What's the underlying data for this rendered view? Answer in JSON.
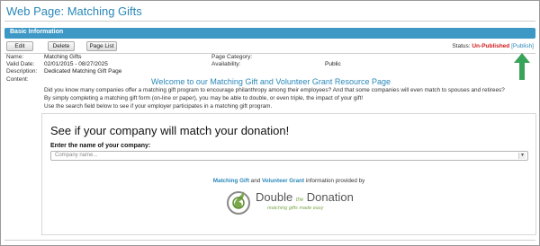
{
  "page_title": "Web Page: Matching Gifts",
  "section": {
    "title": "Basic Information"
  },
  "toolbar": {
    "edit_label": "Edit",
    "delete_label": "Delete",
    "page_list_label": "Page List"
  },
  "status": {
    "label": "Status:",
    "value": "Un-Published",
    "publish_link": "[Publish]"
  },
  "fields": {
    "name_label": "Name:",
    "name_value": "Matching Gifts",
    "valid_date_label": "Valid Date:",
    "valid_date_value": "02/01/2015 - 08/27/2025",
    "description_label": "Description:",
    "description_value": "Dedicated Matching Gift Page",
    "content_label": "Content:",
    "page_category_label": "Page Category:",
    "availability_label": "Availability:",
    "availability_value": "Public"
  },
  "content": {
    "heading": "Welcome to our Matching Gift and Volunteer Grant Resource Page",
    "line1": "Did you know many companies offer a matching gift program to encourage philanthropy among their employees?  And that some companies will even match to spouses and retirees?",
    "line2": "By simply completing a matching gift form (on-line or paper), you may be able to double, or even triple, the impact of your gift!",
    "line3": "Use the search field below to see if your employer participates in a matching gift program."
  },
  "widget": {
    "headline": "See if your company will match your donation!",
    "input_label": "Enter the name of your company:",
    "input_placeholder": "Company name...",
    "provided_part1": "Matching Gift",
    "provided_and": " and ",
    "provided_part2": "Volunteer Grant",
    "provided_suffix": " information provided by",
    "logo_word1": "Double",
    "logo_the": "the",
    "logo_word2": "Donation",
    "logo_tagline": "matching gifts made easy"
  },
  "colors": {
    "accent": "#2a87b8",
    "header_bar": "#3d98c6",
    "unpublished": "#d21a1a",
    "arrow": "#3aa35a"
  },
  "icons": {
    "arrow": "up-arrow-icon",
    "logo": "double-the-donation-logo-icon",
    "select_caret": "chevron-down-icon"
  }
}
